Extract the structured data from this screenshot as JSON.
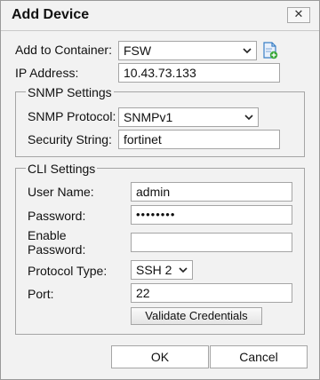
{
  "dialog": {
    "title": "Add Device",
    "close_label": "✕"
  },
  "form": {
    "container_label": "Add to Container:",
    "container_value": "FSW",
    "ip_label": "IP Address:",
    "ip_value": "10.43.73.133"
  },
  "snmp": {
    "legend": "SNMP Settings",
    "protocol_label": "SNMP Protocol:",
    "protocol_value": "SNMPv1",
    "security_label": "Security String:",
    "security_value": "fortinet"
  },
  "cli": {
    "legend": "CLI Settings",
    "username_label": "User Name:",
    "username_value": "admin",
    "password_label": "Password:",
    "password_value": "••••••••",
    "enable_password_label": "Enable Password:",
    "enable_password_value": "",
    "protocol_type_label": "Protocol Type:",
    "protocol_type_value": "SSH 2",
    "port_label": "Port:",
    "port_value": "22",
    "validate_label": "Validate Credentials"
  },
  "footer": {
    "ok_label": "OK",
    "cancel_label": "Cancel"
  },
  "icons": {
    "container_action": "add-container-icon",
    "dropdown": "chevron-down-icon",
    "close": "close-icon"
  },
  "colors": {
    "background": "#f2f2f2",
    "border": "#a5a5a5",
    "icon_blue": "#3a7fc6",
    "icon_green": "#3aa83a"
  }
}
